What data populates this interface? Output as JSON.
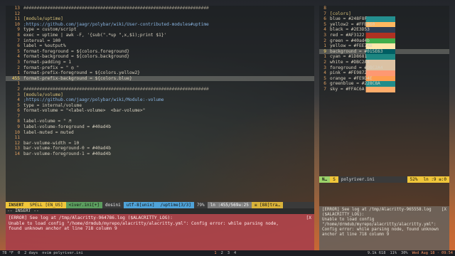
{
  "left_editor": {
    "lines": [
      {
        "n": "13",
        "t": "######################################################################",
        "c": "cmt"
      },
      {
        "n": "12",
        "t": "",
        "c": ""
      },
      {
        "n": "11",
        "t": "[module/uptime]",
        "c": "key"
      },
      {
        "n": "10",
        "t": ";https://github.com/jaagr/polybar/wiki/User-contributed-modules#uptime",
        "c": "url"
      },
      {
        "n": "9",
        "t": "type = custom/script",
        "c": ""
      },
      {
        "n": "8",
        "t": "exec = uptime | awk -F, '{sub(\".*up \",x,$1);print $1}'",
        "c": ""
      },
      {
        "n": "7",
        "t": "interval = 100",
        "c": ""
      },
      {
        "n": "6",
        "t": "label = %output%",
        "c": ""
      },
      {
        "n": "5",
        "t": "format-foreground = ${colors.foreground}",
        "c": ""
      },
      {
        "n": "4",
        "t": "format-background = ${colors.background}",
        "c": ""
      },
      {
        "n": "3",
        "t": "format-padding = 1",
        "c": ""
      },
      {
        "n": "2",
        "t": "format-prefix = \" ◎ \"",
        "c": ""
      },
      {
        "n": "1",
        "t": "format-prefix-foreground = ${colors.yellow2}",
        "c": ""
      },
      {
        "n": "455",
        "t": "format-prefix-background = ${colors.blue}",
        "c": "cur"
      },
      {
        "n": "1",
        "t": "",
        "c": ""
      },
      {
        "n": "2",
        "t": "######################################################################",
        "c": "cmt"
      },
      {
        "n": "3",
        "t": "[module/volume]",
        "c": "key"
      },
      {
        "n": "4",
        "t": ";https://github.com/jaagr/polybar/wiki/Module:-volume",
        "c": "url"
      },
      {
        "n": "5",
        "t": "type = internal/volume",
        "c": ""
      },
      {
        "n": "6",
        "t": "format-volume = \"<label-volume>  <bar-volume>\"",
        "c": ""
      },
      {
        "n": "7",
        "t": "",
        "c": ""
      },
      {
        "n": "8",
        "t": "label-volume = \" ♬",
        "c": ""
      },
      {
        "n": "9",
        "t": "label-volume-foreground = #40ad4b",
        "c": "g"
      },
      {
        "n": "10",
        "t": "label-muted = muted",
        "c": ""
      },
      {
        "n": "11",
        "t": "",
        "c": ""
      },
      {
        "n": "12",
        "t": "bar-volume-width = 10",
        "c": ""
      },
      {
        "n": "13",
        "t": "bar-volume-foreground-0 = #40ad4b",
        "c": "g"
      },
      {
        "n": "14",
        "t": "bar-volume-foreground-1 = #40ad4b",
        "c": "g"
      }
    ],
    "status": {
      "mode": "INSERT",
      "spell": "SPELL [EN_US]",
      "file": "<iver.ini[+]",
      "filetype": "dosini",
      "encoding": "utf-8[unix]",
      "func": "/uptime[3/3]",
      "percent": "79%",
      "position": "ln :455/569≡:25",
      "trailing": "≡ [88]tra…"
    },
    "cmdline": "-- INSERT --",
    "error": {
      "line1": "[ERROR] See log at /tmp/Alacritty-964786.log ($ALACRITTY_LOG):",
      "line2": "Unable to load config \"/home/drmdub/myrepo/alacritty/alacritty.yml\": Config error: while parsing node,",
      "line3": "found unknown anchor at line 718 column 9",
      "tag": "[X"
    }
  },
  "right_editor": {
    "lines": [
      {
        "n": "8",
        "t": ""
      },
      {
        "n": "7",
        "t": "[colors]"
      },
      {
        "n": "6",
        "t": "blue = #248F8F",
        "sw": "#248F8F"
      },
      {
        "n": "5",
        "t": "yellow2 = #FFB860",
        "sw": "#FFB860"
      },
      {
        "n": "4",
        "t": "black = #2E3D53",
        "sw": "#2E3D53"
      },
      {
        "n": "3",
        "t": "red = #AF3122",
        "sw": "#AF3122"
      },
      {
        "n": "2",
        "t": "green = #40ad4b",
        "sw": "#40ad4b"
      },
      {
        "n": "1",
        "t": "yellow = #FEE7AB",
        "sw": "#FEE7AB"
      },
      {
        "n": "9",
        "t": "background = #015E63",
        "sw": "#015E63",
        "cur": true
      },
      {
        "n": "1",
        "t": "cyan = #1D8681",
        "sw": "#1D8681"
      },
      {
        "n": "2",
        "t": "white = #DBC2A4",
        "sw": "#DBC2A4"
      },
      {
        "n": "3",
        "t": "foreground = #DBC2A4",
        "sw": "#DBC2A4"
      },
      {
        "n": "4",
        "t": "pink = #FE9872",
        "sw": "#FE9872"
      },
      {
        "n": "5",
        "t": "orange = #FE9D4E",
        "sw": "#FE9D4E"
      },
      {
        "n": "6",
        "t": "greenblue = #228C8A",
        "sw": "#228C8A"
      },
      {
        "n": "7",
        "t": "sky = #FFAC6A",
        "sw": "#FFAC6A"
      }
    ],
    "status": {
      "mode": "N…",
      "spell": "S",
      "file": "polyriver.ini",
      "percent": "52%",
      "position": "ln :9 ≡:0"
    },
    "error": {
      "line1": "[ERROR] See log at /tmp/Alacritty-965558.log",
      "line2": "($ALACRITTY_LOG):",
      "line3": "Unable to load config",
      "line4": "\"/home/drmdub/myrepo/alacritty/alacritty.yml\":",
      "line5": "Config error: while parsing node, found unknown",
      "line6": "anchor at line 718 column 9",
      "tag": "[X"
    }
  },
  "taskbar": {
    "left": [
      "78 °F",
      "0",
      "2 days",
      "nvim polyriver.ini"
    ],
    "workspaces": [
      "1",
      "2",
      "3",
      "4"
    ],
    "right": [
      "9.1k 618",
      "11%",
      "30%",
      "Wed Aug 18 · 09:54"
    ]
  }
}
